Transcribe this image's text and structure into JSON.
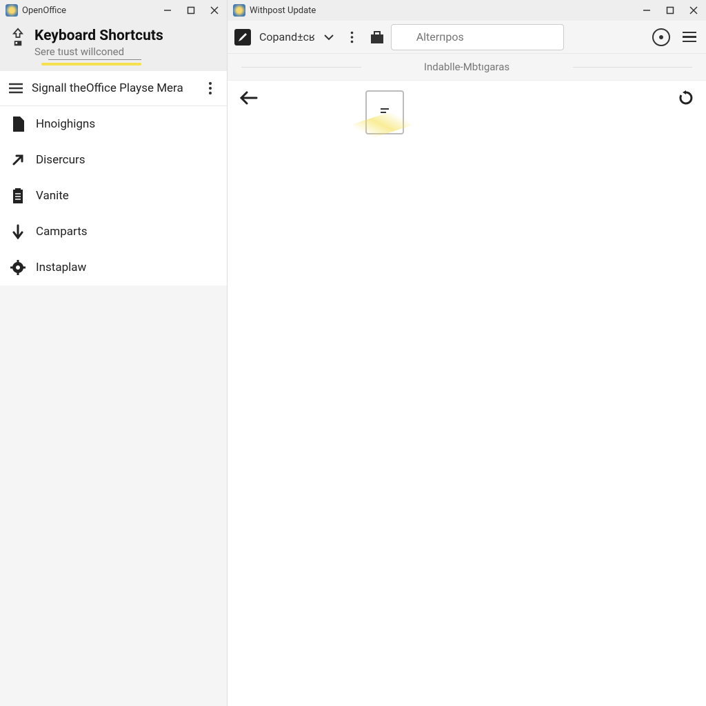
{
  "left_window": {
    "title": "OpenOffice",
    "header": {
      "title": "Keyboard Shortcuts",
      "subtitle": "Sere tıust willconed"
    },
    "section": {
      "title": "Signall theOffice Playse Mera"
    },
    "nav": [
      {
        "label": "Hnoighigns",
        "icon": "document-icon"
      },
      {
        "label": "Disercurs",
        "icon": "arrow-upright-icon"
      },
      {
        "label": "Vanite",
        "icon": "clipboard-icon"
      },
      {
        "label": "Camparts",
        "icon": "arrow-down-icon"
      },
      {
        "label": "Instaplaw",
        "icon": "gear-icon"
      }
    ]
  },
  "right_window": {
    "title": "Withpost Update",
    "toolbar": {
      "dropdown_label": "Copand±cʁ",
      "search_placeholder": "Alterпpos"
    },
    "breadcrumb": "Indablle-Mbtıgaras"
  }
}
